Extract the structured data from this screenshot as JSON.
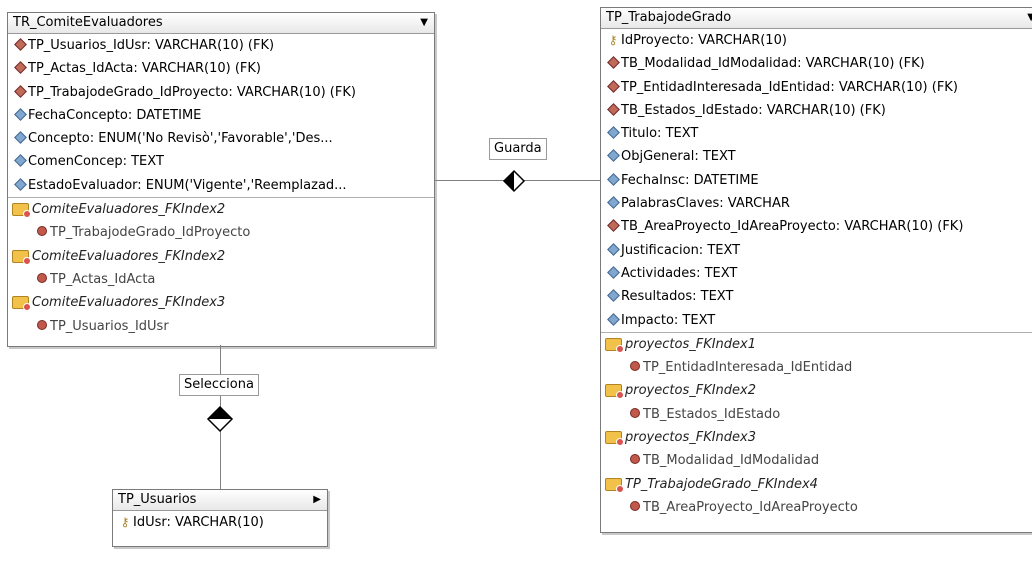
{
  "tables": {
    "comite": {
      "title": "TR_ComiteEvaluadores",
      "columns": [
        {
          "text": "TP_Usuarios_IdUsr: VARCHAR(10) (FK)",
          "icon": "fk-diamond-icon"
        },
        {
          "text": "TP_Actas_IdActa: VARCHAR(10) (FK)",
          "icon": "fk-diamond-icon"
        },
        {
          "text": "TP_TrabajodeGrado_IdProyecto: VARCHAR(10) (FK)",
          "icon": "fk-diamond-icon"
        },
        {
          "text": "FechaConcepto: DATETIME",
          "icon": "column-diamond-icon"
        },
        {
          "text": "Concepto: ENUM('No Revisò','Favorable','Des...",
          "icon": "column-diamond-icon"
        },
        {
          "text": "ComenConcep: TEXT",
          "icon": "column-diamond-icon"
        },
        {
          "text": "EstadoEvaluador: ENUM('Vigente','Reemplazad...",
          "icon": "column-diamond-icon"
        }
      ],
      "indexes": [
        {
          "name": "ComiteEvaluadores_FKIndex2",
          "column": "TP_TrabajodeGrado_IdProyecto"
        },
        {
          "name": "ComiteEvaluadores_FKIndex2",
          "column": "TP_Actas_IdActa"
        },
        {
          "name": "ComiteEvaluadores_FKIndex3",
          "column": "TP_Usuarios_IdUsr"
        }
      ]
    },
    "trabajo": {
      "title": "TP_TrabajodeGrado",
      "columns": [
        {
          "text": "IdProyecto: VARCHAR(10)",
          "icon": "key-icon"
        },
        {
          "text": "TB_Modalidad_IdModalidad: VARCHAR(10) (FK)",
          "icon": "fk-diamond-icon"
        },
        {
          "text": "TP_EntidadInteresada_IdEntidad: VARCHAR(10) (FK)",
          "icon": "fk-diamond-icon"
        },
        {
          "text": "TB_Estados_IdEstado: VARCHAR(10) (FK)",
          "icon": "fk-diamond-icon"
        },
        {
          "text": "Titulo: TEXT",
          "icon": "column-diamond-icon"
        },
        {
          "text": "ObjGeneral: TEXT",
          "icon": "column-diamond-icon"
        },
        {
          "text": "FechaInsc: DATETIME",
          "icon": "column-diamond-icon"
        },
        {
          "text": "PalabrasClaves: VARCHAR",
          "icon": "column-diamond-icon"
        },
        {
          "text": "TB_AreaProyecto_IdAreaProyecto: VARCHAR(10) (FK)",
          "icon": "fk-diamond-icon"
        },
        {
          "text": "Justificacion: TEXT",
          "icon": "column-diamond-icon"
        },
        {
          "text": "Actividades: TEXT",
          "icon": "column-diamond-icon"
        },
        {
          "text": "Resultados: TEXT",
          "icon": "column-diamond-icon"
        },
        {
          "text": "Impacto: TEXT",
          "icon": "column-diamond-icon"
        }
      ],
      "indexes": [
        {
          "name": "proyectos_FKIndex1",
          "column": "TP_EntidadInteresada_IdEntidad"
        },
        {
          "name": "proyectos_FKIndex2",
          "column": "TB_Estados_IdEstado"
        },
        {
          "name": "proyectos_FKIndex3",
          "column": "TB_Modalidad_IdModalidad"
        },
        {
          "name": "TP_TrabajodeGrado_FKIndex4",
          "column": "TB_AreaProyecto_IdAreaProyecto"
        }
      ]
    },
    "usuarios": {
      "title": "TP_Usuarios",
      "columns": [
        {
          "text": "IdUsr: VARCHAR(10)",
          "icon": "key-icon"
        }
      ]
    }
  },
  "relations": {
    "guarda": "Guarda",
    "selecciona": "Selecciona"
  }
}
